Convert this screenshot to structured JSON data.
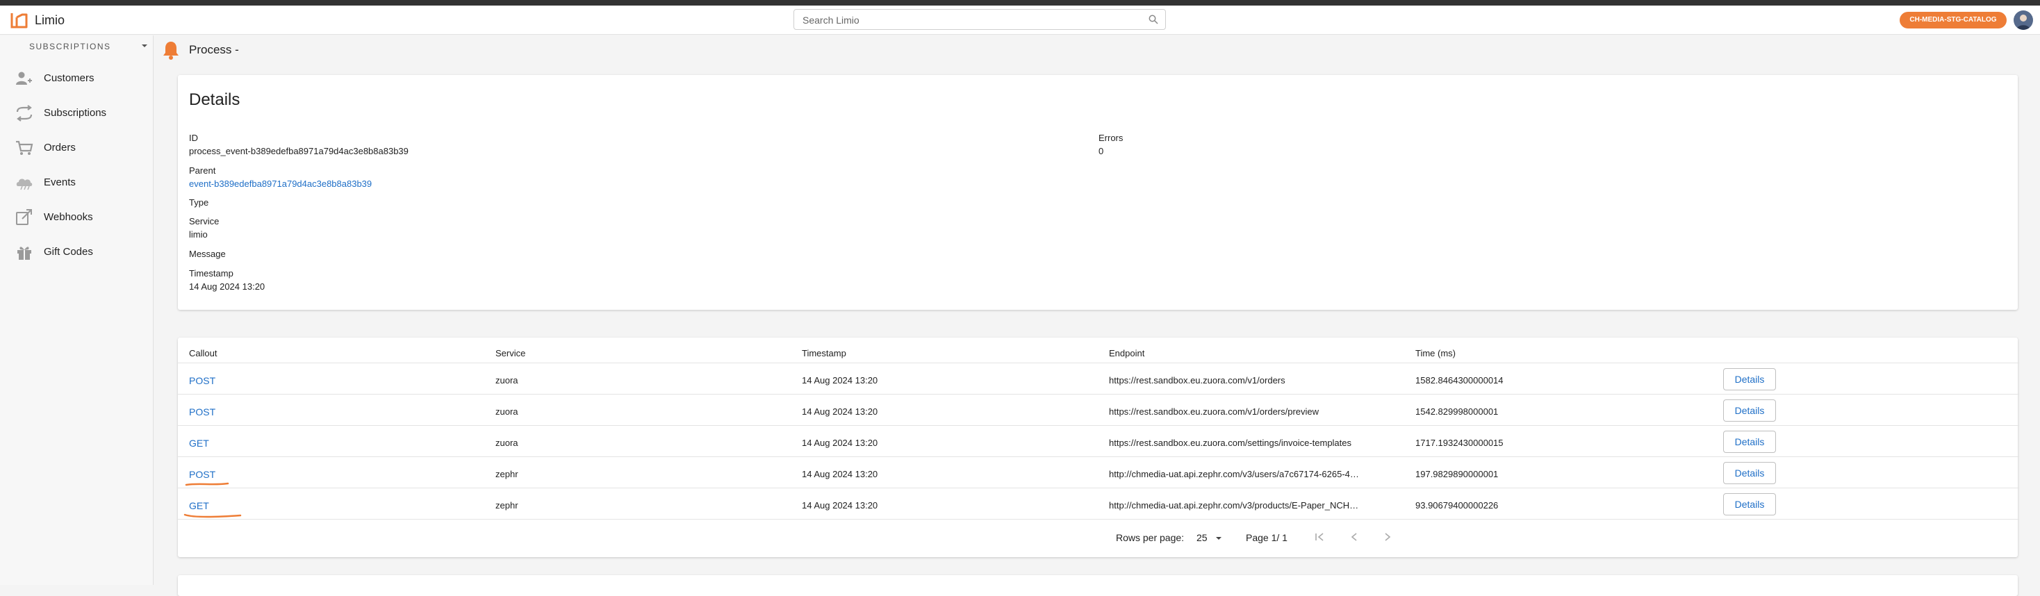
{
  "app": {
    "name": "Limio",
    "search_placeholder": "Search Limio",
    "tenant_badge": "CH-MEDIA-STG-CATALOG"
  },
  "sidebar": {
    "section_label": "SUBSCRIPTIONS",
    "items": [
      {
        "label": "Customers",
        "icon": "customers-icon"
      },
      {
        "label": "Subscriptions",
        "icon": "subscriptions-icon"
      },
      {
        "label": "Orders",
        "icon": "cart-icon"
      },
      {
        "label": "Events",
        "icon": "events-icon"
      },
      {
        "label": "Webhooks",
        "icon": "webhooks-icon"
      },
      {
        "label": "Gift Codes",
        "icon": "gift-icon"
      }
    ]
  },
  "page": {
    "title": "Process -",
    "icon": "bell-icon",
    "accent": "#ee7d36"
  },
  "details": {
    "heading": "Details",
    "fields": {
      "id_label": "ID",
      "id_value": "process_event-b389edefba8971a79d4ac3e8b8a83b39",
      "parent_label": "Parent",
      "parent_value": "event-b389edefba8971a79d4ac3e8b8a83b39",
      "type_label": "Type",
      "service_label": "Service",
      "service_value": "limio",
      "message_label": "Message",
      "timestamp_label": "Timestamp",
      "timestamp_value": "14 Aug 2024 13:20",
      "errors_label": "Errors",
      "errors_value": "0"
    }
  },
  "callouts": {
    "columns": [
      "Callout",
      "Service",
      "Timestamp",
      "Endpoint",
      "Time (ms)"
    ],
    "button_label": "Details",
    "rows": [
      {
        "method": "POST",
        "service": "zuora",
        "timestamp": "14 Aug 2024 13:20",
        "endpoint": "https://rest.sandbox.eu.zuora.com/v1/orders",
        "time": "1582.8464300000014"
      },
      {
        "method": "POST",
        "service": "zuora",
        "timestamp": "14 Aug 2024 13:20",
        "endpoint": "https://rest.sandbox.eu.zuora.com/v1/orders/preview",
        "time": "1542.829998000001"
      },
      {
        "method": "GET",
        "service": "zuora",
        "timestamp": "14 Aug 2024 13:20",
        "endpoint": "https://rest.sandbox.eu.zuora.com/settings/invoice-templates",
        "time": "1717.1932430000015"
      },
      {
        "method": "POST",
        "service": "zephr",
        "timestamp": "14 Aug 2024 13:20",
        "endpoint": "http://chmedia-uat.api.zephr.com/v3/users/a7c67174-6265-4…",
        "time": "197.9829890000001"
      },
      {
        "method": "GET",
        "service": "zephr",
        "timestamp": "14 Aug 2024 13:20",
        "endpoint": "http://chmedia-uat.api.zephr.com/v3/products/E-Paper_NCH…",
        "time": "93.90679400000226"
      }
    ],
    "pagination": {
      "rows_per_page_label": "Rows per page:",
      "rows_per_page_value": "25",
      "page_label": "Page 1/ 1"
    }
  }
}
